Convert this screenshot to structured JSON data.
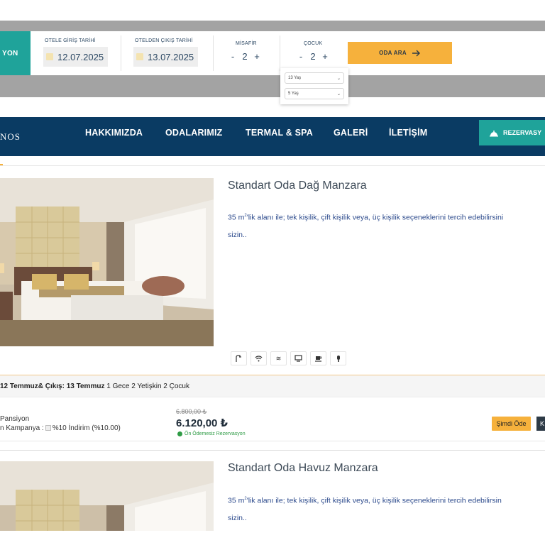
{
  "booking": {
    "tab_label": "YON",
    "checkin_label": "OTELE GİRİŞ TARİHİ",
    "checkin_value": "12.07.2025",
    "checkout_label": "OTELDEN ÇIKIŞ TARİHİ",
    "checkout_value": "13.07.2025",
    "guests_label": "MİSAFİR",
    "guests_value": "2",
    "children_label": "ÇOCUK",
    "children_value": "2",
    "minus": "-",
    "plus": "+",
    "search_label": "ODA ARA",
    "child_ages": [
      "13 Yaş",
      "5 Yaş"
    ]
  },
  "nav": {
    "logo_fragment": "NOS",
    "items": [
      "HAKKIMIZDA",
      "ODALARIMIZ",
      "TERMAL & SPA",
      "GALERİ",
      "İLETİŞİM"
    ],
    "reserve_label": "REZERVASY"
  },
  "rooms": [
    {
      "title": "Standart Oda Dağ Manzara",
      "desc_prefix": "35 m",
      "desc_rest": "'lik alanı ile; tek kişilik, çift kişilik veya, üç kişilik seçeneklerini tercih edebilirsini",
      "desc_line2": "sizin..",
      "amenities": [
        "shower-icon",
        "wifi-icon",
        "air-conditioner-icon",
        "tv-icon",
        "coffee-icon",
        "hairdryer-icon"
      ]
    },
    {
      "title": "Standart Oda Havuz Manzara",
      "desc_prefix": "35 m",
      "desc_rest": "'lik alanı ile; tek kişilik, çift kişilik veya, üç kişilik seçeneklerini tercih edebilirsin",
      "desc_line2": "sizin.."
    }
  ],
  "stay": {
    "dates_bold": "12 Temmuz& Çıkış: 13 Temmuz",
    "summary": " 1 Gece 2 Yetişkin 2 Çocuk"
  },
  "price": {
    "board": "Pansiyon",
    "campaign_prefix": "n Kampanya :",
    "campaign_text": "%10 İndirim (%10.00)",
    "old_price": "6.800,00 ₺",
    "new_price": "6.120,00 ₺",
    "no_prepay": "Ön Ödemesiz Rezervasyon",
    "pay_label": "Şimdi Öde",
    "other_label": "K"
  },
  "colors": {
    "teal": "#1fa39a",
    "navy": "#0a3b63",
    "accent": "#f6b13c",
    "green": "#2e9b45"
  }
}
